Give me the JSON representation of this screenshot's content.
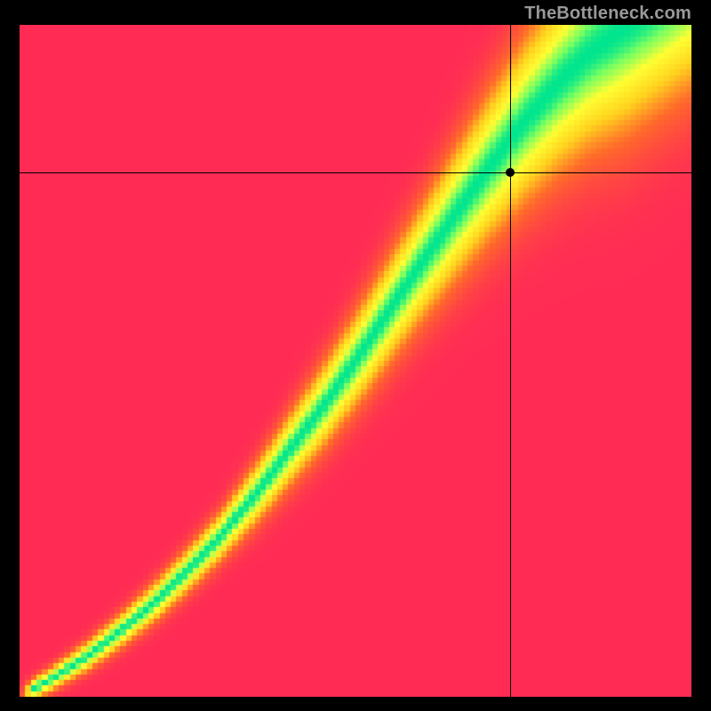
{
  "watermark": "TheBottleneck.com",
  "chart_data": {
    "type": "heatmap",
    "title": "",
    "xlabel": "",
    "ylabel": "",
    "xlim": [
      0,
      1
    ],
    "ylim": [
      0,
      1
    ],
    "crosshair": {
      "x": 0.73,
      "y": 0.781
    },
    "ridge": [
      {
        "x": 0.0,
        "y": 0.0
      },
      {
        "x": 0.05,
        "y": 0.028
      },
      {
        "x": 0.1,
        "y": 0.06
      },
      {
        "x": 0.15,
        "y": 0.098
      },
      {
        "x": 0.2,
        "y": 0.14
      },
      {
        "x": 0.25,
        "y": 0.188
      },
      {
        "x": 0.3,
        "y": 0.24
      },
      {
        "x": 0.35,
        "y": 0.3
      },
      {
        "x": 0.4,
        "y": 0.365
      },
      {
        "x": 0.45,
        "y": 0.43
      },
      {
        "x": 0.5,
        "y": 0.5
      },
      {
        "x": 0.55,
        "y": 0.575
      },
      {
        "x": 0.6,
        "y": 0.648
      },
      {
        "x": 0.65,
        "y": 0.72
      },
      {
        "x": 0.7,
        "y": 0.79
      },
      {
        "x": 0.75,
        "y": 0.855
      },
      {
        "x": 0.8,
        "y": 0.912
      },
      {
        "x": 0.85,
        "y": 0.96
      },
      {
        "x": 0.9,
        "y": 0.995
      }
    ],
    "ridge_sigma_at": [
      {
        "x": 0.0,
        "sigma": 0.01
      },
      {
        "x": 0.3,
        "sigma": 0.025
      },
      {
        "x": 0.6,
        "sigma": 0.06
      },
      {
        "x": 0.9,
        "sigma": 0.11
      }
    ],
    "color_stops": [
      {
        "t": 0.0,
        "color": "#ff2b55"
      },
      {
        "t": 0.3,
        "color": "#ff6a2a"
      },
      {
        "t": 0.55,
        "color": "#ffd21e"
      },
      {
        "t": 0.78,
        "color": "#ffff33"
      },
      {
        "t": 0.92,
        "color": "#7bff60"
      },
      {
        "t": 1.0,
        "color": "#00e58f"
      }
    ],
    "pixelation": 120
  }
}
